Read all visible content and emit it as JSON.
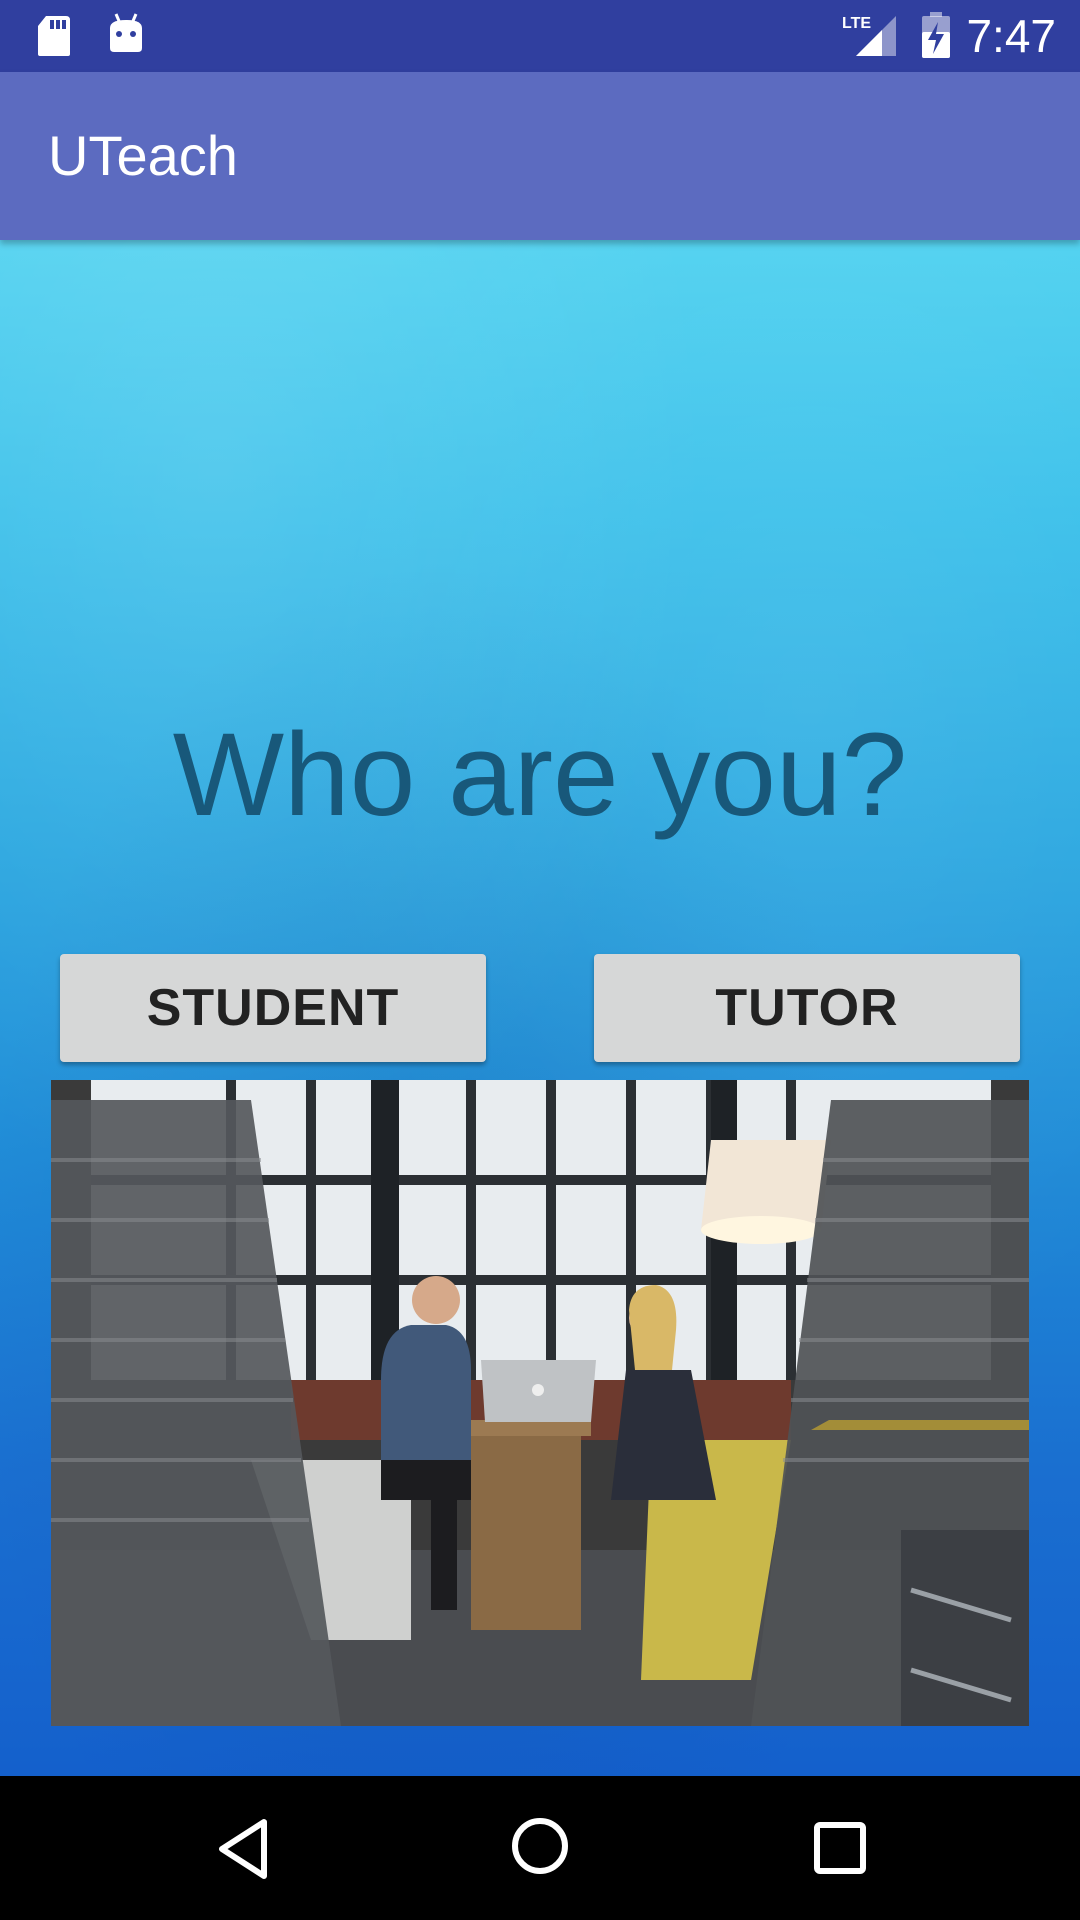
{
  "status_bar": {
    "time": "7:47",
    "icons": [
      "sd-card-icon",
      "android-debug-icon",
      "lte-signal-icon",
      "battery-charging-icon"
    ],
    "network": "LTE"
  },
  "app_bar": {
    "title": "UTeach",
    "color": "#5c6bc0"
  },
  "main": {
    "headline": "Who are you?",
    "buttons": {
      "student": "STUDENT",
      "tutor": "TUTOR"
    },
    "image": "photo-of-two-people-at-laptop"
  },
  "nav_bar": {
    "icons": [
      "back-icon",
      "home-icon",
      "recents-icon"
    ]
  },
  "colors": {
    "status_bar": "#303f9f",
    "app_bar": "#5c6bc0",
    "headline": "#18587a",
    "button_bg": "#d6d7d7"
  }
}
